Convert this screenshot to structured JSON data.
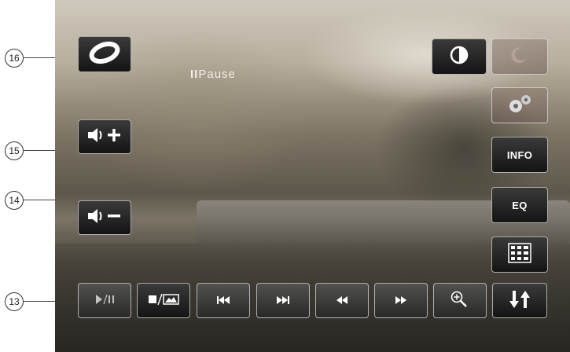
{
  "callouts": [
    "16",
    "15",
    "14",
    "13"
  ],
  "status": {
    "pause_label": "Pause"
  },
  "buttons": {
    "info_label": "INFO",
    "eq_label": "EQ"
  },
  "icons": {
    "logo": "disc-logo-icon",
    "brightness": "contrast-icon",
    "night": "moon-icon",
    "settings": "gears-icon",
    "keypad": "keypad-icon",
    "volume_up": "volume-up-icon",
    "volume_down": "volume-down-icon",
    "play_pause": "play-pause-icon",
    "stop_photo": "stop-photo-icon",
    "prev": "skip-previous-icon",
    "next": "skip-next-icon",
    "rewind": "rewind-icon",
    "forward": "fast-forward-icon",
    "zoom": "zoom-icon",
    "sort": "down-up-arrows-icon"
  },
  "colors": {
    "button_border": "#e6e6e6",
    "button_bg": "#2a2a2a",
    "text": "#ffffff"
  }
}
